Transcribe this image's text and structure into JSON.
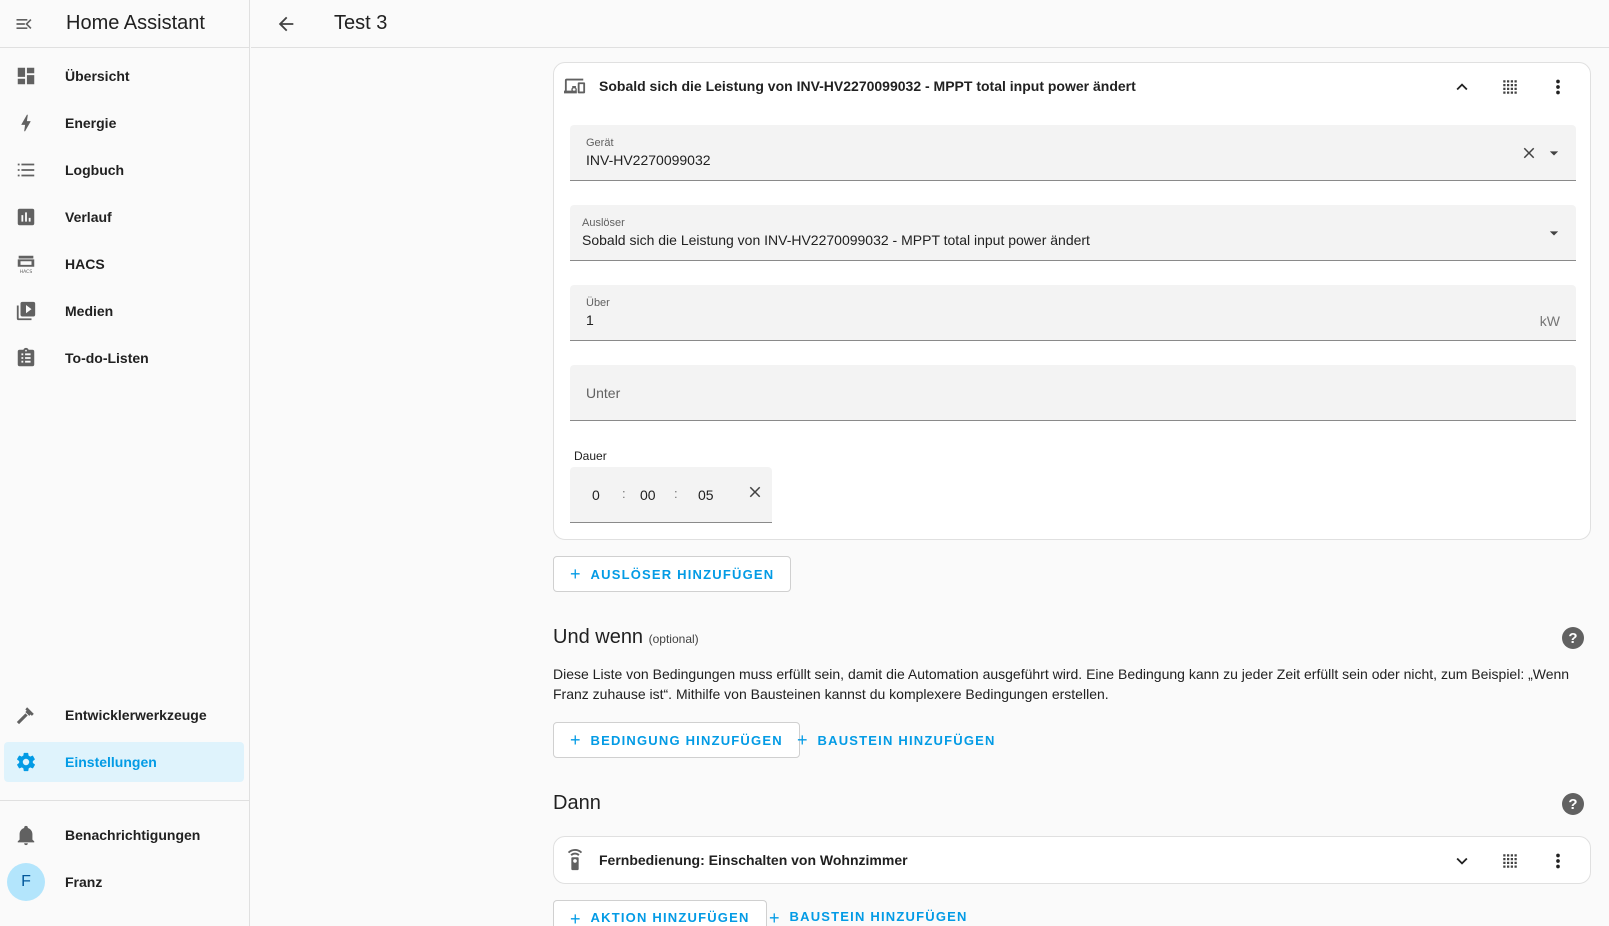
{
  "sidebar": {
    "title": "Home Assistant",
    "items": [
      {
        "label": "Übersicht",
        "icon": "dashboard-icon"
      },
      {
        "label": "Energie",
        "icon": "lightning-bolt-icon"
      },
      {
        "label": "Logbuch",
        "icon": "format-list-icon"
      },
      {
        "label": "Verlauf",
        "icon": "chart-box-icon"
      },
      {
        "label": "HACS",
        "icon": "hacs-icon"
      },
      {
        "label": "Medien",
        "icon": "play-box-multiple-icon"
      },
      {
        "label": "To-do-Listen",
        "icon": "clipboard-list-icon"
      }
    ],
    "bottom_items": [
      {
        "label": "Entwicklerwerkzeuge",
        "icon": "hammer-icon"
      },
      {
        "label": "Einstellungen",
        "icon": "cog-icon",
        "active": true
      }
    ],
    "notifications_label": "Benachrichtigungen",
    "user": {
      "name": "Franz",
      "initial": "F"
    }
  },
  "header": {
    "title": "Test 3"
  },
  "trigger_card": {
    "title": "Sobald sich die Leistung von INV-HV2270099032 - MPPT total input power ändert",
    "device": {
      "label": "Gerät",
      "value": "INV-HV2270099032"
    },
    "trigger": {
      "label": "Auslöser",
      "value": "Sobald sich die Leistung von INV-HV2270099032 - MPPT total input power ändert"
    },
    "above": {
      "label": "Über",
      "value": "1",
      "unit": "kW"
    },
    "below": {
      "placeholder": "Unter"
    },
    "duration": {
      "label": "Dauer",
      "hours": "0",
      "minutes": "00",
      "seconds": "05",
      "separator": ":"
    }
  },
  "add_trigger_label": "AUSLÖSER HINZUFÜGEN",
  "conditions": {
    "title": "Und wenn",
    "optional": "(optional)",
    "description": "Diese Liste von Bedingungen muss erfüllt sein, damit die Automation ausgeführt wird. Eine Bedingung kann zu jeder Zeit erfüllt sein oder nicht, zum Beispiel: „Wenn Franz zuhause ist“. Mithilfe von Bausteinen kannst du komplexere Bedingungen erstellen.",
    "add_condition_label": "BEDINGUNG HINZUFÜGEN",
    "add_building_block_label": "BAUSTEIN HINZUFÜGEN"
  },
  "actions": {
    "title": "Dann",
    "card_title": "Fernbedienung: Einschalten von Wohnzimmer",
    "add_action_label": "AKTION HINZUFÜGEN",
    "add_building_block_label": "BAUSTEIN HINZUFÜGEN"
  },
  "colors": {
    "accent": "#039be5",
    "active_bg": "#dff3fc"
  }
}
